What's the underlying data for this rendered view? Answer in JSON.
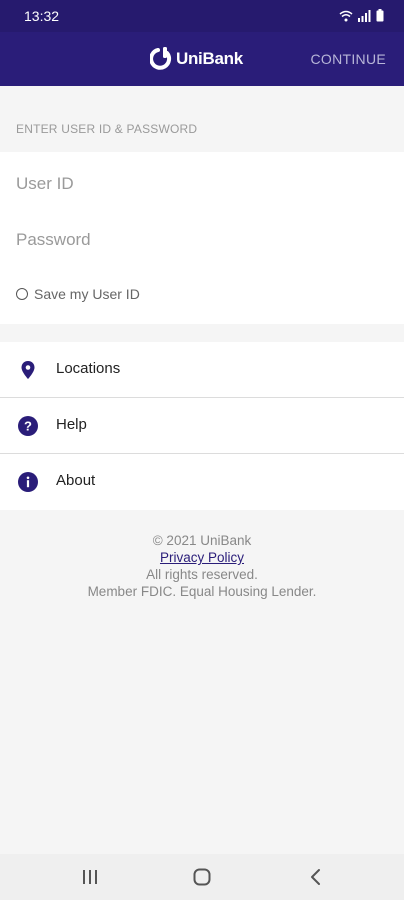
{
  "status_bar": {
    "time": "13:32"
  },
  "app_bar": {
    "brand": "UniBank",
    "continue_label": "CONTINUE"
  },
  "login": {
    "section_title": "ENTER USER ID & PASSWORD",
    "user_id_placeholder": "User ID",
    "password_placeholder": "Password",
    "save_label": "Save my User ID"
  },
  "menu": {
    "items": [
      {
        "label": "Locations",
        "icon": "location-pin-icon"
      },
      {
        "label": "Help",
        "icon": "help-circle-icon"
      },
      {
        "label": "About",
        "icon": "info-circle-icon"
      }
    ]
  },
  "footer": {
    "copyright": "© 2021 UniBank",
    "privacy": "Privacy Policy",
    "rights": "All rights reserved.",
    "member": "Member FDIC. Equal Housing Lender."
  },
  "colors": {
    "brand": "#2a1d79",
    "status_bar": "#261a6e"
  }
}
